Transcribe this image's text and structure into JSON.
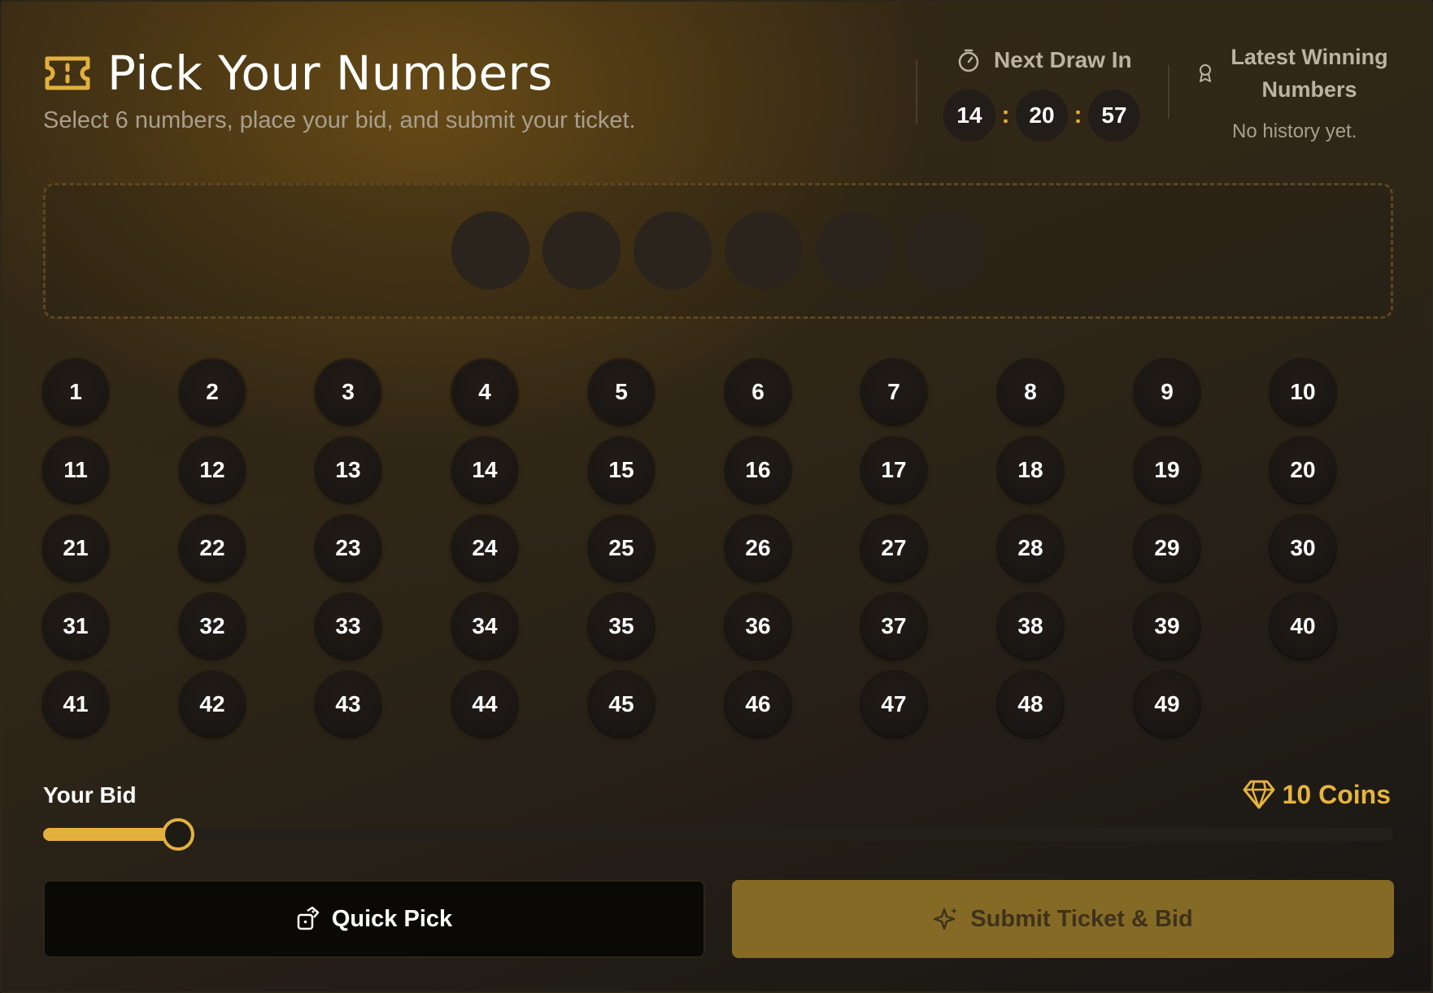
{
  "header": {
    "title": "Pick Your Numbers",
    "subtitle": "Select 6 numbers, place your bid, and submit your ticket.",
    "ticket_icon": "ticket-icon"
  },
  "next_draw": {
    "label": "Next Draw In",
    "icon": "stopwatch-icon",
    "hours": "14",
    "minutes": "20",
    "seconds": "57",
    "separator": ":"
  },
  "latest_winning": {
    "title": "Latest Winning Numbers",
    "icon": "medal-icon",
    "empty_text": "No history yet."
  },
  "selected_slots": {
    "count": 6,
    "values": [
      "",
      "",
      "",
      "",
      "",
      ""
    ]
  },
  "number_grid": {
    "numbers": [
      "1",
      "2",
      "3",
      "4",
      "5",
      "6",
      "7",
      "8",
      "9",
      "10",
      "11",
      "12",
      "13",
      "14",
      "15",
      "16",
      "17",
      "18",
      "19",
      "20",
      "21",
      "22",
      "23",
      "24",
      "25",
      "26",
      "27",
      "28",
      "29",
      "30",
      "31",
      "32",
      "33",
      "34",
      "35",
      "36",
      "37",
      "38",
      "39",
      "40",
      "41",
      "42",
      "43",
      "44",
      "45",
      "46",
      "47",
      "48",
      "49"
    ],
    "columns": 10
  },
  "bid": {
    "label": "Your Bid",
    "amount_text": "10 Coins",
    "icon": "gem-icon",
    "slider_fraction": 0.1
  },
  "buttons": {
    "quick_pick": "Quick Pick",
    "quick_pick_icon": "dice-icon",
    "submit": "Submit Ticket & Bid",
    "submit_icon": "sparkle-icon"
  },
  "colors": {
    "accent": "#e2b13d",
    "submit_bg": "#856a26",
    "ball_bg": "#1a1613"
  }
}
